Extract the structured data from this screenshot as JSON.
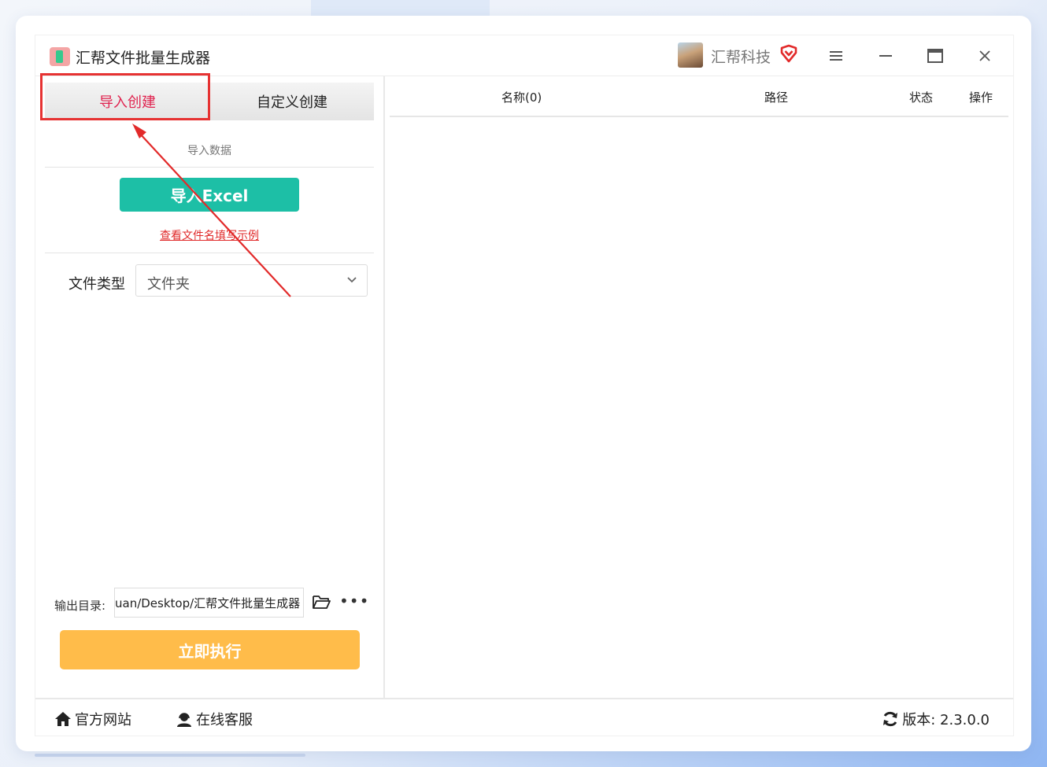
{
  "app": {
    "title": "汇帮文件批量生成器"
  },
  "user": {
    "name": "汇帮科技"
  },
  "tabs": [
    {
      "label": "导入创建"
    },
    {
      "label": "自定义创建"
    }
  ],
  "import_section": {
    "label": "导入数据",
    "button": "导入Excel",
    "example_link": "查看文件名填写示例"
  },
  "file_type": {
    "label": "文件类型",
    "value": "文件夹"
  },
  "output": {
    "label": "输出目录:",
    "path": "uan/Desktop/汇帮文件批量生成器"
  },
  "run_button": "立即执行",
  "table": {
    "columns": [
      "名称(0)",
      "路径",
      "状态",
      "操作"
    ]
  },
  "footer": {
    "website": "官方网站",
    "support": "在线客服",
    "version": "版本: 2.3.0.0"
  },
  "colors": {
    "accent_tab": "#e0234f",
    "import_button": "#1dbfa6",
    "run_button": "#ffbc4a",
    "highlight": "#e63232"
  }
}
